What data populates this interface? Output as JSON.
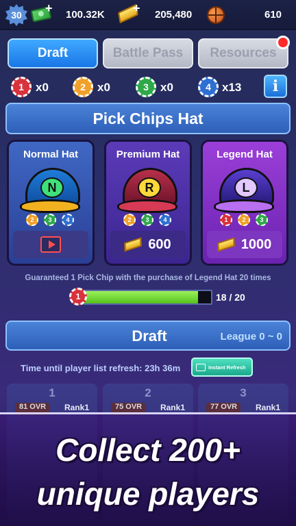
{
  "topbar": {
    "level": "30",
    "cash": "100.32K",
    "gold": "205,480",
    "basketballs": "610"
  },
  "tabs": [
    {
      "label": "Draft",
      "active": true
    },
    {
      "label": "Battle Pass",
      "active": false
    },
    {
      "label": "Resources",
      "active": false,
      "notification": true
    }
  ],
  "chips": [
    {
      "number": "1",
      "count": "x0",
      "color": "#d8323c"
    },
    {
      "number": "2",
      "count": "x0",
      "color": "#f0a12a"
    },
    {
      "number": "3",
      "count": "x0",
      "color": "#2fa84a"
    },
    {
      "number": "4",
      "count": "x13",
      "color": "#2f6fd1"
    }
  ],
  "info_label": "i",
  "pick_banner": "Pick Chips Hat",
  "hats": [
    {
      "label": "Normal Hat",
      "letter": "N",
      "price": "",
      "icon": "video-icon"
    },
    {
      "label": "Premium Hat",
      "letter": "R",
      "price": "600",
      "icon": "gold-icon"
    },
    {
      "label": "Legend Hat",
      "letter": "L",
      "price": "1000",
      "icon": "gold-icon"
    }
  ],
  "guarantee_text": "Guaranteed 1 Pick Chip with the purchase of Legend Hat 20 times",
  "progress": {
    "current": 18,
    "total": 20,
    "text": "18 / 20"
  },
  "draft": {
    "title": "Draft",
    "league": "League 0 ~ 0",
    "timer": "Time until player list refresh: 23h 36m",
    "instant_refresh": "Instant Refresh",
    "slots": [
      {
        "num": "1",
        "ovr": "81 OVR",
        "rank": "Rank1"
      },
      {
        "num": "2",
        "ovr": "75 OVR",
        "rank": "Rank1"
      },
      {
        "num": "3",
        "ovr": "77 OVR",
        "rank": "Rank1"
      }
    ]
  },
  "promo": {
    "line1": "Collect 200+",
    "line2": "unique players"
  }
}
